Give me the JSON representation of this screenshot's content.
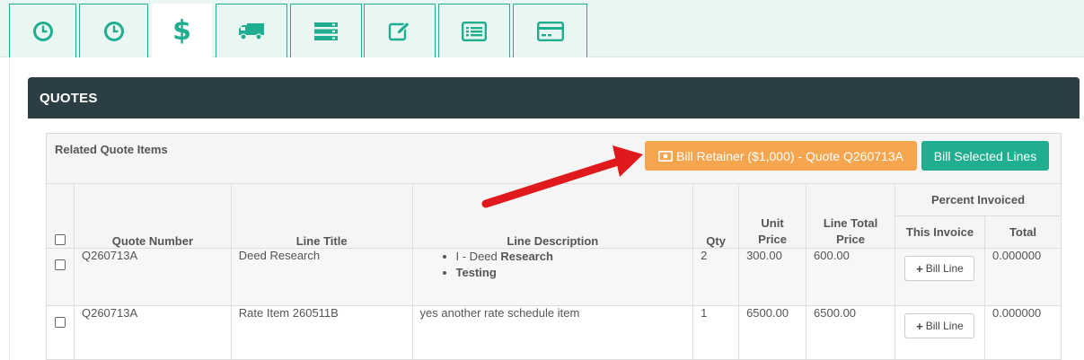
{
  "tabs": [
    {
      "icon": "clock-icon",
      "active": false
    },
    {
      "icon": "clock-icon",
      "active": false
    },
    {
      "icon": "dollar-icon",
      "active": true
    },
    {
      "icon": "truck-icon",
      "active": false
    },
    {
      "icon": "server-icon",
      "active": false
    },
    {
      "icon": "edit-icon",
      "active": false
    },
    {
      "icon": "list-icon",
      "active": false
    },
    {
      "icon": "credit-card-icon",
      "active": false
    }
  ],
  "panel": {
    "title": "QUOTES"
  },
  "related": {
    "title": "Related Quote Items",
    "bill_retainer_label": "Bill Retainer ($1,000) - Quote Q260713A",
    "bill_selected_label": "Bill Selected Lines"
  },
  "table": {
    "headers": {
      "quote_number": "Quote Number",
      "line_title": "Line Title",
      "line_description": "Line Description",
      "qty": "Qty",
      "unit_price": "Unit Price",
      "line_total_price": "Line Total Price",
      "percent_invoiced": "Percent Invoiced",
      "this_invoice": "This Invoice",
      "total": "Total"
    },
    "bill_line_label": "Bill Line",
    "rows": [
      {
        "quote_number": "Q260713A",
        "line_title": "Deed Research",
        "desc_item1_prefix": "I - Deed ",
        "desc_item1_bold": "Research",
        "desc_item2": "Testing",
        "qty": "2",
        "unit_price": "300.00",
        "line_total": "600.00",
        "total": "0.000000"
      },
      {
        "quote_number": "Q260713A",
        "line_title": "Rate Item 260511B",
        "description": "yes another rate schedule item",
        "qty": "1",
        "unit_price": "6500.00",
        "line_total": "6500.00",
        "total": "0.000000"
      }
    ]
  },
  "colors": {
    "accent": "#1fae8f",
    "warning": "#f6a54f",
    "header_dark": "#2b3e43",
    "annotation_arrow": "#e0191c"
  }
}
